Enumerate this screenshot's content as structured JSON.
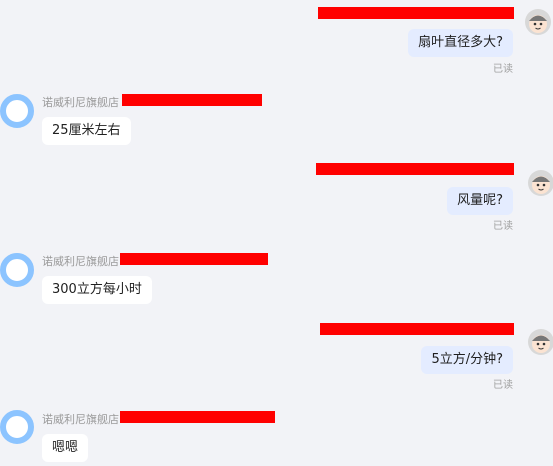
{
  "messages": [
    {
      "side": "out",
      "text": "扇叶直径多大?",
      "status": "已读"
    },
    {
      "side": "in",
      "seller": "诺威利尼旗舰店",
      "text": "25厘米左右"
    },
    {
      "side": "out",
      "text": "风量呢?",
      "status": "已读"
    },
    {
      "side": "in",
      "seller": "诺威利尼旗舰店",
      "text": "300立方每小时"
    },
    {
      "side": "out",
      "text": "5立方/分钟?",
      "status": "已读"
    },
    {
      "side": "in",
      "seller": "诺威利尼旗舰店",
      "text": "嗯嗯"
    }
  ],
  "colors": {
    "background": "#f2f3f7",
    "outgoing_bubble": "#e4ecff",
    "incoming_bubble": "#ffffff",
    "redaction": "#ff0000",
    "shop_avatar_ring": "#8cc4ff"
  },
  "icons": {
    "user_avatar": "cartoon-face-icon",
    "shop_avatar": "shop-ring-avatar-icon"
  }
}
